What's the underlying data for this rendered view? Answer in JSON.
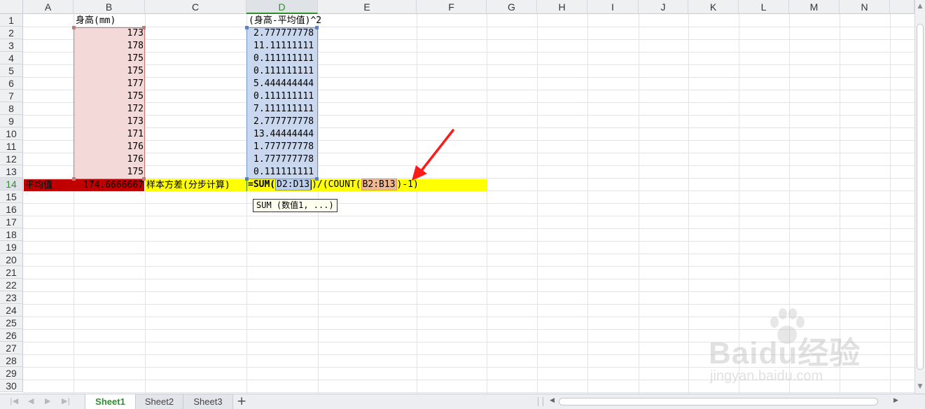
{
  "columns": [
    "A",
    "B",
    "C",
    "D",
    "E",
    "F",
    "G",
    "H",
    "I",
    "J",
    "K",
    "L",
    "M",
    "N"
  ],
  "rows": [
    "1",
    "2",
    "3",
    "4",
    "5",
    "6",
    "7",
    "8",
    "9",
    "10",
    "11",
    "12",
    "13",
    "14",
    "15",
    "16",
    "17",
    "18",
    "19",
    "20",
    "21",
    "22",
    "23",
    "24",
    "25",
    "26",
    "27",
    "28",
    "29",
    "30"
  ],
  "active_cell": "D14",
  "header_b": "身高(mm)",
  "header_d": "(身高-平均值)^2",
  "heights": [
    "173",
    "178",
    "175",
    "175",
    "177",
    "175",
    "172",
    "173",
    "171",
    "176",
    "176",
    "175"
  ],
  "squares": [
    "2.777777778",
    "11.11111111",
    "0.111111111",
    "0.111111111",
    "5.444444444",
    "0.111111111",
    "7.111111111",
    "2.777777778",
    "13.44444444",
    "1.777777778",
    "1.777777778",
    "0.111111111"
  ],
  "row14": {
    "label": "平均值",
    "avg_value": "174.6666667",
    "variance_label": "样本方差(分步计算)",
    "formula": {
      "prefix": "=SUM(",
      "ref1": "D2:D13",
      "middle": ")/(COUNT(",
      "ref2": "B2:B13",
      "suffix": ")-1)"
    }
  },
  "tooltip": "SUM (数值1, ...)",
  "sheet_tabs": [
    "Sheet1",
    "Sheet2",
    "Sheet3"
  ],
  "active_tab": "Sheet1",
  "watermark": {
    "line1": "Baidu经验",
    "line2": "jingyan.baidu.com"
  },
  "colors": {
    "row14_red": "#c00000",
    "row14_yellow": "#ffff00",
    "selection_b": "#f4d9d9",
    "selection_d": "#c9d8ef",
    "active_green": "#2c8f2c",
    "arrow_red": "#ff1a1a"
  }
}
